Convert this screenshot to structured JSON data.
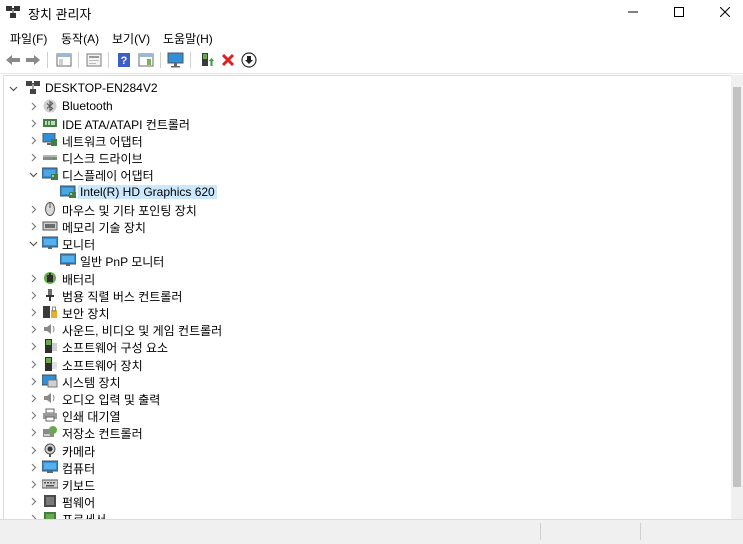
{
  "window": {
    "title": "장치 관리자",
    "minimize_glyph": "─",
    "maximize_glyph": "☐",
    "close_glyph": "✕"
  },
  "menu": [
    {
      "label": "파일(F)"
    },
    {
      "label": "동작(A)"
    },
    {
      "label": "보기(V)"
    },
    {
      "label": "도움말(H)"
    }
  ],
  "toolbar": [
    {
      "icon": "back-arrow-icon"
    },
    {
      "icon": "forward-arrow-icon"
    },
    {
      "icon": "show-hide-console-tree-icon"
    },
    {
      "icon": "properties-icon"
    },
    {
      "icon": "help-icon"
    },
    {
      "icon": "action-pane-icon"
    },
    {
      "icon": "scan-hardware-icon"
    },
    {
      "icon": "update-driver-icon"
    },
    {
      "icon": "uninstall-device-icon"
    },
    {
      "icon": "download-driver-icon"
    }
  ],
  "tree": {
    "root": "DESKTOP-EN284V2",
    "items": [
      {
        "label": "Bluetooth",
        "icon": "bluetooth-icon",
        "expanded": false
      },
      {
        "label": "IDE ATA/ATAPI 컨트롤러",
        "icon": "ide-controller-icon",
        "expanded": false
      },
      {
        "label": "네트워크 어댑터",
        "icon": "network-adapter-icon",
        "expanded": false
      },
      {
        "label": "디스크 드라이브",
        "icon": "disk-drive-icon",
        "expanded": false
      },
      {
        "label": "디스플레이 어댑터",
        "icon": "display-adapter-icon",
        "expanded": true
      },
      {
        "label": "Intel(R) HD Graphics 620",
        "icon": "display-adapter-icon",
        "child": true,
        "selected": true
      },
      {
        "label": "마우스 및 기타 포인팅 장치",
        "icon": "mouse-icon",
        "expanded": false
      },
      {
        "label": "메모리 기술 장치",
        "icon": "memory-device-icon",
        "expanded": false
      },
      {
        "label": "모니터",
        "icon": "monitor-icon",
        "expanded": true
      },
      {
        "label": "일반 PnP 모니터",
        "icon": "monitor-icon",
        "child": true
      },
      {
        "label": "배터리",
        "icon": "battery-icon",
        "expanded": false
      },
      {
        "label": "범용 직렬 버스 컨트롤러",
        "icon": "usb-icon",
        "expanded": false
      },
      {
        "label": "보안 장치",
        "icon": "security-device-icon",
        "expanded": false
      },
      {
        "label": "사운드, 비디오 및 게임 컨트롤러",
        "icon": "speaker-icon",
        "expanded": false
      },
      {
        "label": "소프트웨어 구성 요소",
        "icon": "software-component-icon",
        "expanded": false
      },
      {
        "label": "소프트웨어 장치",
        "icon": "software-device-icon",
        "expanded": false
      },
      {
        "label": "시스템 장치",
        "icon": "system-device-icon",
        "expanded": false
      },
      {
        "label": "오디오 입력 및 출력",
        "icon": "speaker-icon",
        "expanded": false
      },
      {
        "label": "인쇄 대기열",
        "icon": "printer-icon",
        "expanded": false
      },
      {
        "label": "저장소 컨트롤러",
        "icon": "storage-controller-icon",
        "expanded": false
      },
      {
        "label": "카메라",
        "icon": "camera-icon",
        "expanded": false
      },
      {
        "label": "컴퓨터",
        "icon": "computer-icon",
        "expanded": false
      },
      {
        "label": "키보드",
        "icon": "keyboard-icon",
        "expanded": false
      },
      {
        "label": "펌웨어",
        "icon": "firmware-icon",
        "expanded": false
      },
      {
        "label": "프로세서",
        "icon": "processor-icon",
        "expanded": false
      }
    ]
  },
  "colors": {
    "selection": "#cce8ff",
    "uninstall_red": "#e0201e",
    "monitor_blue": "#2f8fd8"
  }
}
